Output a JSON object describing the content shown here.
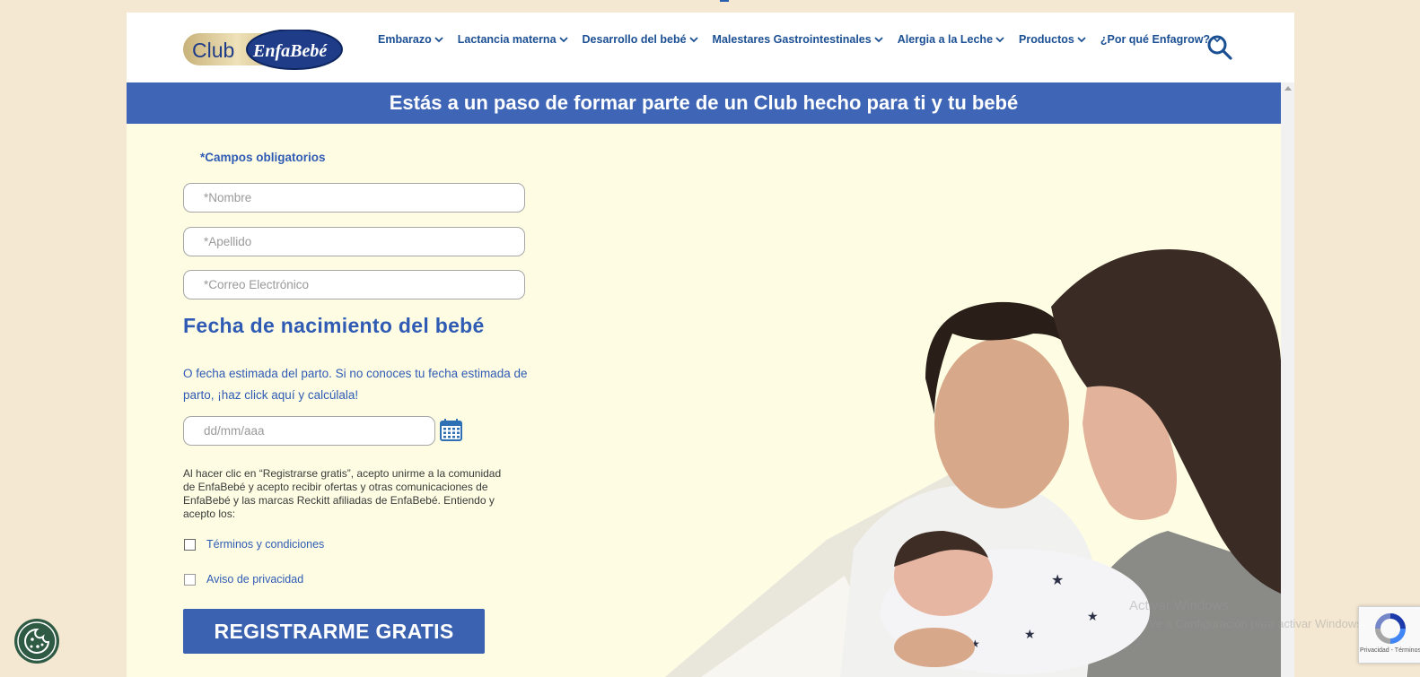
{
  "header": {
    "logo_text_club": "Club",
    "logo_text_brand": "EnfaBebé",
    "nav": [
      {
        "label": "Embarazo"
      },
      {
        "label": "Lactancia materna"
      },
      {
        "label": "Desarrollo del bebé"
      },
      {
        "label": "Malestares Gastrointestinales"
      },
      {
        "label": "Alergia a la Leche"
      },
      {
        "label": "Productos"
      },
      {
        "label": "¿Por qué Enfagrow?"
      }
    ]
  },
  "banner": {
    "title": "Estás a un paso de formar parte de un Club hecho para ti y tu bebé"
  },
  "form": {
    "required_note": "*Campos obligatorios",
    "first_name_placeholder": "*Nombre",
    "last_name_placeholder": "*Apellido",
    "email_placeholder": "*Correo Electrónico",
    "dob_title": "Fecha de nacimiento del bebé",
    "dob_sub_prefix": "O fecha estimada del parto. Si no conoces tu fecha estimada de parto, ",
    "dob_link": "¡haz click aquí y calcúlala!",
    "date_placeholder": "dd/mm/aaa",
    "consent_text": "Al hacer clic en “Registrarse gratis”, acepto unirme a la comunidad de EnfaBebé y acepto recibir ofertas y otras comunicaciones de EnfaBebé y las marcas Reckitt afiliadas de EnfaBebé. Entiendo y acepto los:",
    "terms_label": "Términos y condiciones",
    "privacy_label": "Aviso de privacidad",
    "submit_label": "REGISTRARME GRATIS"
  },
  "overlay": {
    "windows_line1": "Activar Windows",
    "windows_line2": "Ve a Configuración para activar Windows.",
    "recaptcha_text": "Privacidad - Términos"
  },
  "colors": {
    "page_bg": "#f4e8d2",
    "banner_bg": "#3f66b6",
    "form_bg": "#fefde3",
    "accent": "#2f5bb4",
    "button_bg": "#3b62b0",
    "cookie_bg": "#2f5b45"
  },
  "icons": [
    "chevron-down-icon",
    "search-icon",
    "calendar-icon",
    "cookie-icon",
    "recaptcha-icon"
  ]
}
